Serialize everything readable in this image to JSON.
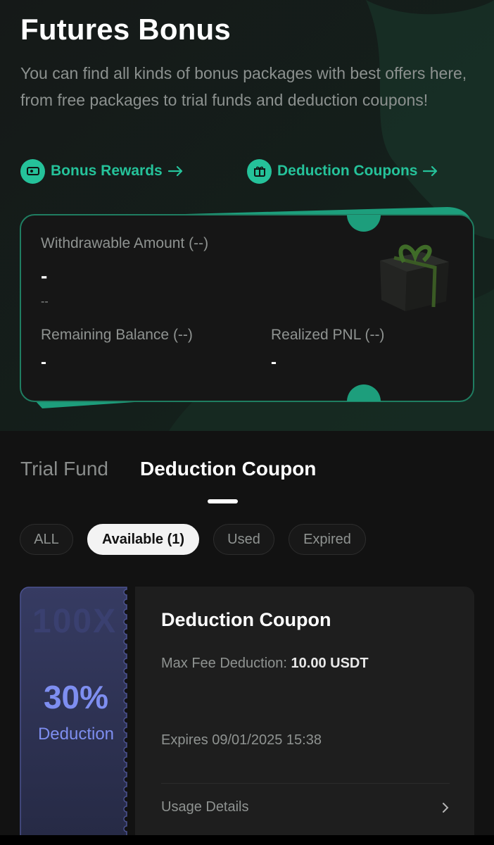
{
  "header": {
    "title": "Futures Bonus",
    "description": "You can find all kinds of bonus packages with best offers here, from free packages to trial funds and deduction coupons!"
  },
  "links": [
    {
      "label": "Bonus Rewards",
      "icon": "ticket-icon"
    },
    {
      "label": "Deduction Coupons",
      "icon": "gift-icon"
    }
  ],
  "summary_card": {
    "withdrawable_label": "Withdrawable Amount (--)",
    "withdrawable_value": "-",
    "withdrawable_sub": "--",
    "remaining_label": "Remaining Balance (--)",
    "remaining_value": "-",
    "pnl_label": "Realized PNL (--)",
    "pnl_value": "-"
  },
  "tabs": [
    {
      "label": "Trial Fund",
      "active": false
    },
    {
      "label": "Deduction Coupon",
      "active": true
    }
  ],
  "filters": [
    {
      "label": "ALL",
      "active": false
    },
    {
      "label": "Available (1)",
      "active": true
    },
    {
      "label": "Used",
      "active": false
    },
    {
      "label": "Expired",
      "active": false
    }
  ],
  "coupon": {
    "watermark": "100X",
    "percent": "30%",
    "percent_label": "Deduction",
    "title": "Deduction Coupon",
    "max_fee_label": "Max Fee Deduction: ",
    "max_fee_value": "10.00 USDT",
    "expires": "Expires 09/01/2025 15:38",
    "usage_label": "Usage Details"
  },
  "colors": {
    "accent": "#25c29a",
    "coupon_accent": "#7e8ef0",
    "background": "#121212"
  }
}
